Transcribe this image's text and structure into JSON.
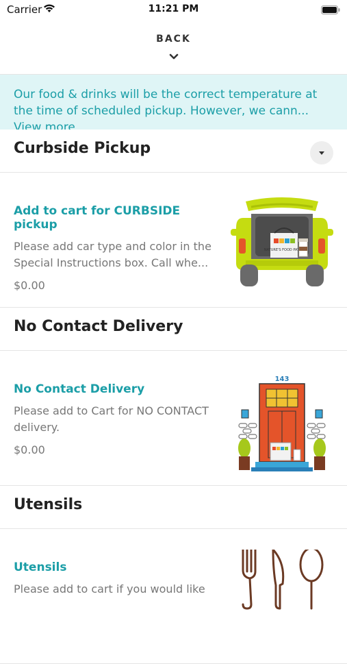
{
  "status_bar": {
    "carrier": "Carrier",
    "time": "11:21 PM"
  },
  "nav": {
    "back_label": "BACK"
  },
  "notice": {
    "text": "Our food & drinks will be the correct temperature at the time of scheduled pickup. However, we cann...",
    "link": "View more"
  },
  "sections": [
    {
      "title": "Curbside Pickup",
      "item": {
        "title": "Add to cart for CURBSIDE pickup",
        "description": "Please add car type and color in the Special Instructions box. Call whe...",
        "price": "$0.00"
      }
    },
    {
      "title": "No Contact Delivery",
      "item": {
        "title": "No Contact Delivery",
        "description": "Please add to Cart for NO CONTACT delivery.",
        "price": "$0.00",
        "door_number": "143"
      }
    },
    {
      "title": "Utensils",
      "item": {
        "title": "Utensils",
        "description": "Please add to cart if you would like"
      }
    }
  ],
  "brand_bag_text": "NATURE'S FOOD PATCH",
  "colors": {
    "accent": "#1b9ea7",
    "notice_bg": "#dff5f6",
    "car": "#c5dc11",
    "door": "#e4542a"
  }
}
